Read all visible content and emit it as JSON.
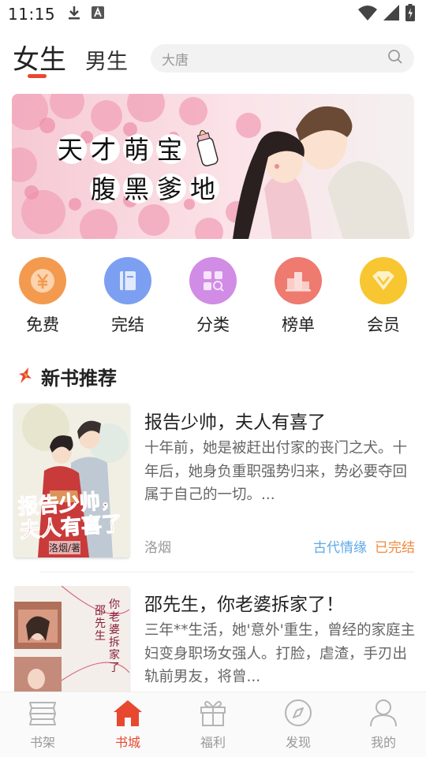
{
  "status_bar": {
    "time": "11:15"
  },
  "header": {
    "tabs": [
      {
        "label": "女生"
      },
      {
        "label": "男生"
      }
    ],
    "search": {
      "placeholder": "大唐"
    }
  },
  "banner": {
    "line1": "天才萌宝",
    "line2": "腹黑爹地"
  },
  "categories": [
    {
      "label": "免费",
      "icon": "yen-icon",
      "color": "#f39a4f"
    },
    {
      "label": "完结",
      "icon": "book-icon",
      "color": "#7d9ff2"
    },
    {
      "label": "分类",
      "icon": "grid-search-icon",
      "color": "#d18ce6"
    },
    {
      "label": "榜单",
      "icon": "podium-icon",
      "color": "#ee7a70"
    },
    {
      "label": "会员",
      "icon": "diamond-icon",
      "color": "#f7c630"
    }
  ],
  "section": {
    "title": "新书推荐"
  },
  "books": [
    {
      "title": "报告少帅，夫人有喜了",
      "desc": "十年前，她是被赶出付家的丧门之犬。十年后，她身负重职强势归来，势必要夺回属于自己的一切。...",
      "author": "洛烟",
      "genre": "古代情缘",
      "status": "已完结",
      "cover_title": "报告少帅，夫人有喜了",
      "cover_author": "洛烟/著"
    },
    {
      "title": "邵先生，你老婆拆家了！",
      "desc": "三年**生活，她'意外'重生，曾经的家庭主妇变身职场女强人。打脸，虐渣，手刃出轨前男友，将曾...",
      "cover_title_a": "邵先生",
      "cover_title_b": "你老婆拆家了"
    }
  ],
  "bottom_nav": [
    {
      "label": "书架",
      "icon": "bookshelf-icon"
    },
    {
      "label": "书城",
      "icon": "home-icon"
    },
    {
      "label": "福利",
      "icon": "gift-icon"
    },
    {
      "label": "发现",
      "icon": "compass-icon"
    },
    {
      "label": "我的",
      "icon": "user-icon"
    }
  ],
  "colors": {
    "accent": "#e8482f",
    "genre_tag": "#5fa8e8",
    "status_tag": "#f08a3c"
  }
}
